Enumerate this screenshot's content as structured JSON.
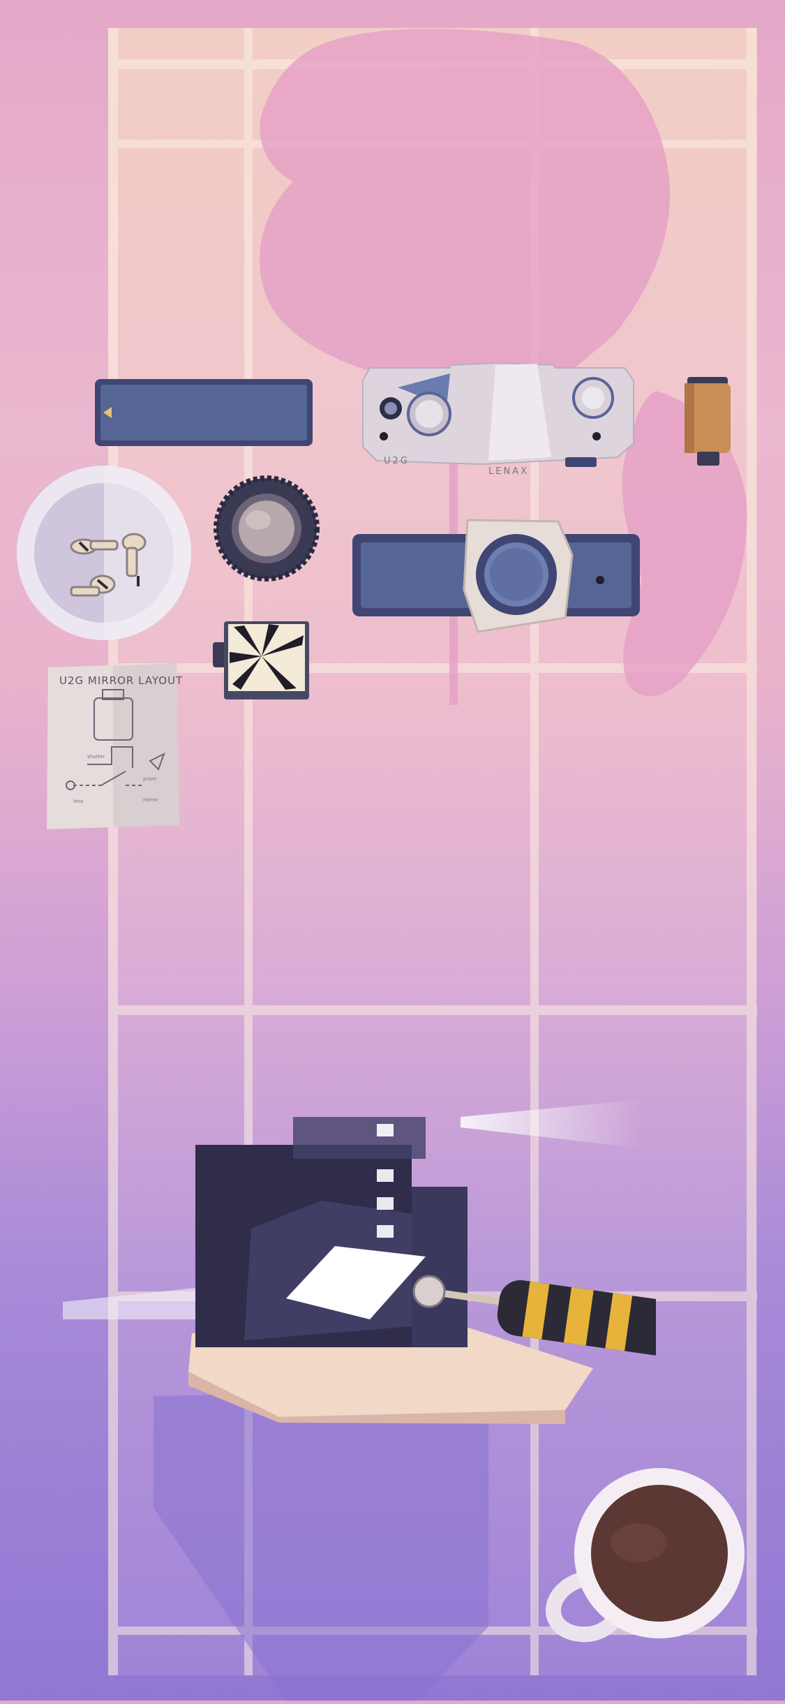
{
  "scene": {
    "name": "camera-repair-workbench",
    "colors": {
      "wall_top": "#e4a8c8",
      "wall_bottom": "#8f77d3",
      "window_light": "#f6dcc8",
      "panel_blue": "#556594",
      "panel_dark": "#3f4674",
      "body_cream": "#ddd4de",
      "screwdriver_yellow": "#e7b43b",
      "screwdriver_black": "#2b2a36",
      "coffee": "#5c3834"
    }
  },
  "parts": {
    "top_body_marking_left": "U2G",
    "top_body_marking_right": "LENAX",
    "manual_title": "U2G MIRROR LAYOUT",
    "bowl_icon": "screw-bowl-icon",
    "lens_ring_icon": "lens-ring-icon",
    "film_canister_icon": "film-canister-icon",
    "mirror_card_icon": "mirror-card-icon"
  },
  "tools": {
    "screwdriver_icon": "screwdriver-icon",
    "coffee_icon": "coffee-mug-icon"
  }
}
